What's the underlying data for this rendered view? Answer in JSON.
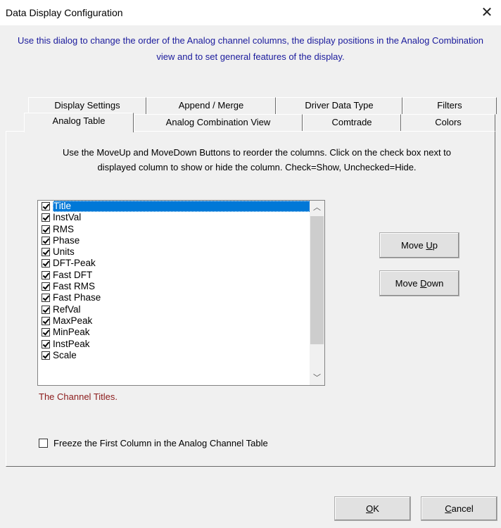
{
  "window": {
    "title": "Data Display Configuration",
    "close_glyph": "✕"
  },
  "intro_text": "Use this dialog to change the order of the Analog channel columns, the display positions in the Analog Combination view and to set general features of the display.",
  "tabs": {
    "back_row": [
      "Display Settings",
      "Append / Merge",
      "Driver Data Type",
      "Filters"
    ],
    "front_row": [
      "Analog Table",
      "Analog Combination View",
      "Comtrade",
      "Colors"
    ],
    "selected": "Analog Table"
  },
  "instructions": "Use the MoveUp and MoveDown Buttons to reorder the columns.  Click on the check box next to displayed column to show or hide the column. Check=Show, Unchecked=Hide.",
  "columns": [
    {
      "label": "Title",
      "checked": true,
      "selected": true
    },
    {
      "label": "InstVal",
      "checked": true
    },
    {
      "label": "RMS",
      "checked": true
    },
    {
      "label": "Phase",
      "checked": true
    },
    {
      "label": "Units",
      "checked": true
    },
    {
      "label": "DFT-Peak",
      "checked": true
    },
    {
      "label": "Fast DFT",
      "checked": true
    },
    {
      "label": "Fast RMS",
      "checked": true
    },
    {
      "label": "Fast Phase",
      "checked": true
    },
    {
      "label": "RefVal",
      "checked": true
    },
    {
      "label": "MaxPeak",
      "checked": true
    },
    {
      "label": "MinPeak",
      "checked": true
    },
    {
      "label": "InstPeak",
      "checked": true
    },
    {
      "label": "Scale",
      "checked": true
    }
  ],
  "channel_description": "The Channel Titles.",
  "freeze_label": "Freeze the First Column in the Analog Channel Table",
  "freeze_checked": false,
  "buttons": {
    "move_up": {
      "pre": "Move ",
      "accel": "U",
      "post": "p"
    },
    "move_down": {
      "pre": "Move ",
      "accel": "D",
      "post": "own"
    },
    "ok": {
      "pre": "",
      "accel": "O",
      "post": "K"
    },
    "cancel": {
      "pre": "",
      "accel": "C",
      "post": "ancel"
    }
  },
  "colors": {
    "intro_text": "#1a1a9c",
    "description_text": "#8b1a1a",
    "selection": "#0078d7"
  },
  "icons": {
    "close": "close-icon",
    "scroll_up": "chevron-up-icon",
    "scroll_down": "chevron-down-icon",
    "checkbox": "checkbox-checked-icon"
  }
}
